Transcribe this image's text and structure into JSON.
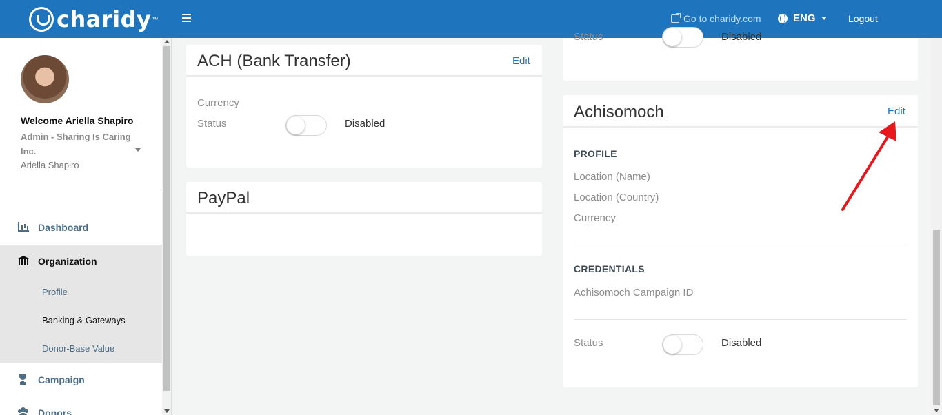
{
  "topbar": {
    "logo_text": "charidy",
    "logo_tm": "™",
    "goto_label": "Go to charidy.com",
    "lang_label": "ENG",
    "logout_label": "Logout"
  },
  "sidebar": {
    "welcome": "Welcome Ariella Shapiro",
    "role": "Admin - Sharing Is Caring Inc.",
    "username": "Ariella Shapiro",
    "nav": {
      "dashboard": "Dashboard",
      "organization": "Organization",
      "profile": "Profile",
      "banking": "Banking & Gateways",
      "donor_base": "Donor-Base Value",
      "campaign": "Campaign",
      "donors": "Donors"
    }
  },
  "ach": {
    "title": "ACH (Bank Transfer)",
    "edit": "Edit",
    "currency_label": "Currency",
    "status_label": "Status",
    "status_value": "Disabled"
  },
  "paypal": {
    "title": "PayPal"
  },
  "top_right_card": {
    "status_label": "Status",
    "status_value": "Disabled"
  },
  "achisomoch": {
    "title": "Achisomoch",
    "edit": "Edit",
    "profile_head": "PROFILE",
    "location_name": "Location (Name)",
    "location_country": "Location (Country)",
    "currency": "Currency",
    "credentials_head": "CREDENTIALS",
    "campaign_id": "Achisomoch Campaign ID",
    "status_label": "Status",
    "status_value": "Disabled"
  },
  "colors": {
    "brand": "#1f75bd",
    "annotation_arrow": "#e8171b"
  }
}
